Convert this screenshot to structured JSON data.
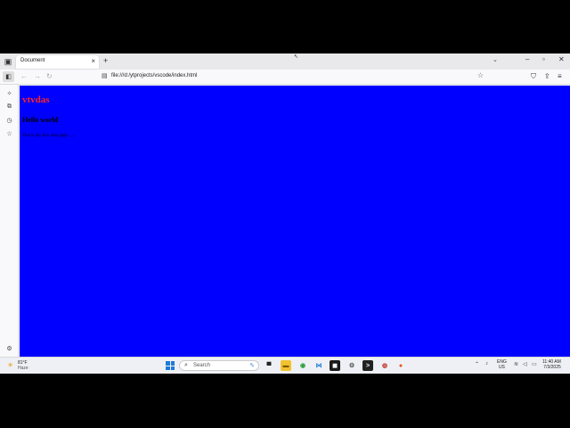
{
  "tab": {
    "title": "Document",
    "close": "×"
  },
  "new_tab": "+",
  "tab_list": "⌄",
  "window_controls": {
    "minimize": "–",
    "maximize": "▫",
    "close": "✕"
  },
  "nav": {
    "back": "←",
    "forward": "→",
    "reload": "↻"
  },
  "url": "file:///d:/ytprojects/vscode/index.html",
  "page": {
    "heading1": "vtvdas",
    "heading2": "Hello world",
    "paragraph": "This is my first web page ......",
    "background": "#0000ff",
    "heading1_color": "#ff2222"
  },
  "taskbar": {
    "temperature": "81°F",
    "condition": "Haze",
    "search_placeholder": "Search",
    "language_top": "ENG",
    "language_bottom": "US",
    "time": "11:40 AM",
    "date": "7/3/2025"
  }
}
